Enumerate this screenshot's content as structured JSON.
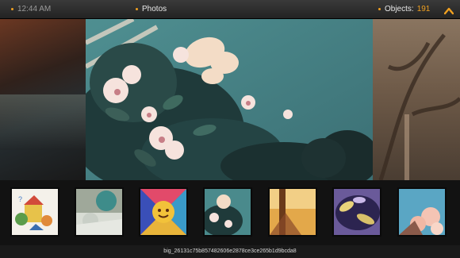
{
  "topbar": {
    "clock": "12:44 AM",
    "title": "Photos",
    "objects_label": "Objects:",
    "objects_count": "191"
  },
  "icons": {
    "up": "chevron-up-icon"
  },
  "colors": {
    "accent": "#f0a020",
    "bar": "#2b2b2b"
  },
  "thumbnails": [
    {
      "name": "thumb-cartoon"
    },
    {
      "name": "thumb-garden"
    },
    {
      "name": "thumb-sun-mandala"
    },
    {
      "name": "thumb-flowers-teal"
    },
    {
      "name": "thumb-golden-sunset"
    },
    {
      "name": "thumb-purple-leaves"
    },
    {
      "name": "thumb-pink-blossoms"
    }
  ],
  "footer": {
    "filename": "big_26131c75b857482606e2878ce3ce265b1d9bcda8"
  }
}
